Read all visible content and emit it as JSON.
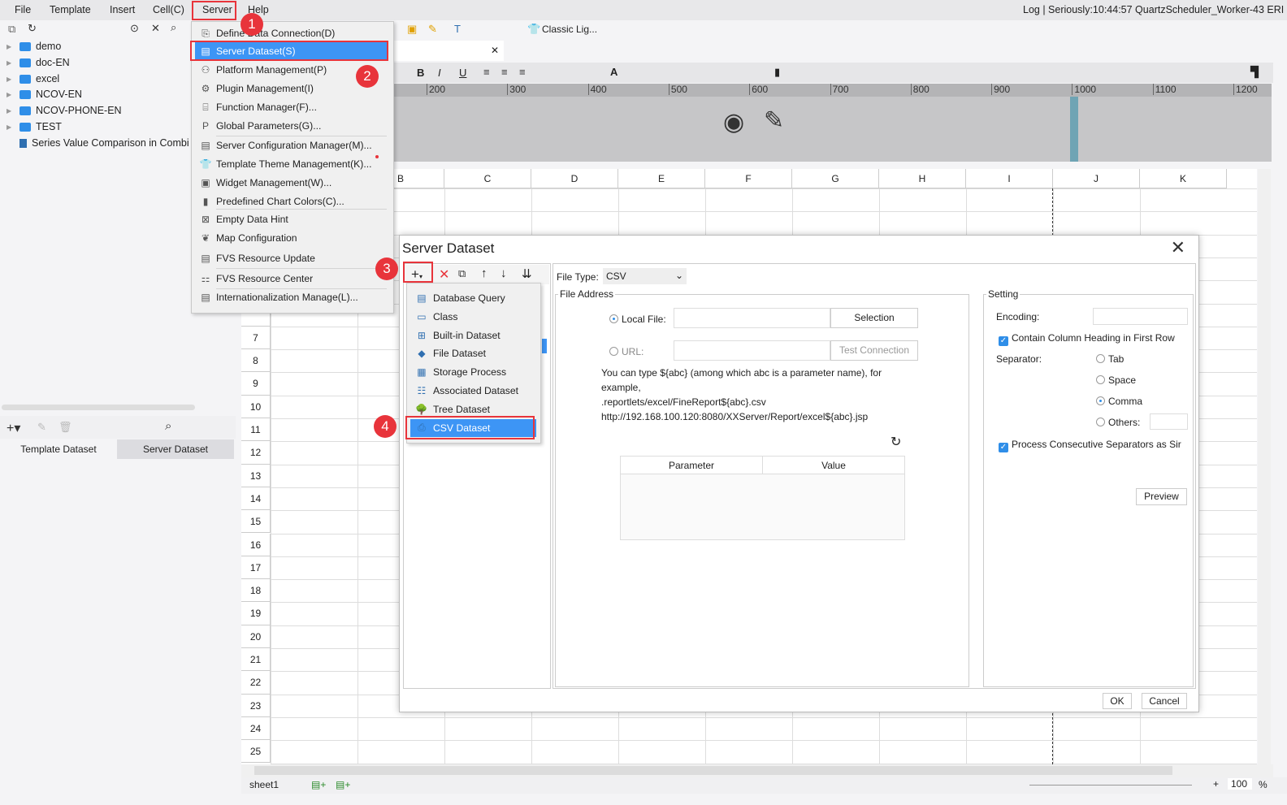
{
  "menubar": {
    "items": [
      "File",
      "Template",
      "Insert",
      "Cell(C)",
      "Server",
      "Help"
    ],
    "log": "Log | Seriously:10:44:57 QuartzScheduler_Worker-43 ERI"
  },
  "toolbar": {
    "theme": "Classic Lig..."
  },
  "tree": [
    "demo",
    "doc-EN",
    "excel",
    "NCOV-EN",
    "NCOV-PHONE-EN",
    "TEST"
  ],
  "tree_file": "Series Value Comparison in Combi",
  "dataset_tabs": [
    "Template Dataset",
    "Server Dataset"
  ],
  "ruler": [
    "200",
    "300",
    "400",
    "500",
    "600",
    "700",
    "800",
    "900",
    "1000",
    "1100",
    "1200"
  ],
  "columns": [
    "B",
    "C",
    "D",
    "E",
    "F",
    "G",
    "H",
    "I",
    "J",
    "K"
  ],
  "rows": [
    "7",
    "8",
    "9",
    "10",
    "11",
    "12",
    "13",
    "14",
    "15",
    "16",
    "17",
    "18",
    "19",
    "20",
    "21",
    "22",
    "23",
    "24",
    "25"
  ],
  "sheet": {
    "tab": "sheet1",
    "zoom": "100",
    "pct": "%"
  },
  "server_menu": [
    "Define Data Connection(D)",
    "Server Dataset(S)",
    "Platform Management(P)",
    "Plugin Management(I)",
    "Function Manager(F)...",
    "Global Parameters(G)...",
    "Server Configuration Manager(M)...",
    "Template Theme Management(K)...",
    "Widget Management(W)...",
    "Predefined Chart Colors(C)...",
    "Empty Data Hint",
    "Map Configuration",
    "FVS Resource Update",
    "FVS Resource Center",
    "Internationalization Manage(L)..."
  ],
  "badges": [
    "1",
    "2",
    "3",
    "4"
  ],
  "dialog": {
    "title": "Server Dataset",
    "add_menu": [
      "Database Query",
      "Class",
      "Built-in Dataset",
      "File Dataset",
      "Storage Process",
      "Associated Dataset",
      "Tree Dataset",
      "CSV Dataset"
    ],
    "file_type_label": "File Type:",
    "file_type": "CSV",
    "file_address": "File Address",
    "local_file": "Local File:",
    "selection": "Selection",
    "url": "URL:",
    "test_connection": "Test Connection",
    "hint": [
      "You can type ${abc} (among which abc is a parameter name), for",
      "example,",
      ".reportlets/excel/FineReport${abc}.csv",
      "http://192.168.100.120:8080/XXServer/Report/excel${abc}.jsp"
    ],
    "param_headers": [
      "Parameter",
      "Value"
    ],
    "setting": "Setting",
    "encoding": "Encoding:",
    "contain_heading": "Contain Column Heading in First Row",
    "separator": "Separator:",
    "separators": [
      "Tab",
      "Space",
      "Comma",
      "Others:"
    ],
    "process_consecutive": "Process Consecutive Separators as Sir",
    "preview": "Preview",
    "ok": "OK",
    "cancel": "Cancel"
  }
}
